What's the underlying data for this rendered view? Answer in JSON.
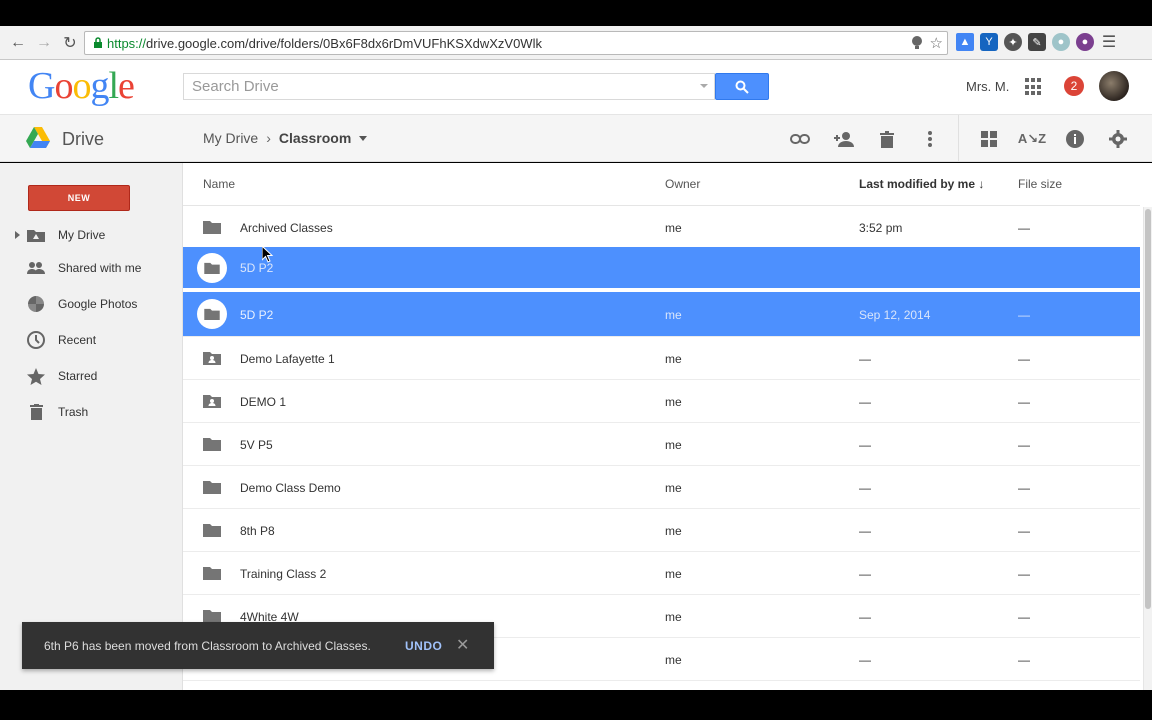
{
  "browser": {
    "url_scheme": "https://",
    "url_rest": "drive.google.com/drive/folders/0Bx6F8dx6rDmVUFhKSXdwXzV0Wlk"
  },
  "header": {
    "logo": [
      "G",
      "o",
      "o",
      "g",
      "l",
      "e"
    ],
    "logo_colors": [
      "#4285f4",
      "#ea4335",
      "#fbbc05",
      "#4285f4",
      "#34a853",
      "#ea4335"
    ],
    "search_placeholder": "Search Drive",
    "user_name": "Mrs. M.",
    "notification_count": "2"
  },
  "drive_bar": {
    "title": "Drive",
    "breadcrumb_root": "My Drive",
    "breadcrumb_current": "Classroom"
  },
  "sidebar": {
    "new_label": "NEW",
    "items": [
      {
        "label": "My Drive",
        "icon": "my-drive-icon"
      },
      {
        "label": "Shared with me",
        "icon": "people-icon"
      },
      {
        "label": "Google Photos",
        "icon": "photos-icon"
      },
      {
        "label": "Recent",
        "icon": "clock-icon"
      },
      {
        "label": "Starred",
        "icon": "star-icon"
      },
      {
        "label": "Trash",
        "icon": "trash-icon"
      }
    ]
  },
  "list": {
    "columns": {
      "name": "Name",
      "owner": "Owner",
      "modified": "Last modified by me",
      "size": "File size"
    },
    "drag_label": "5D P2",
    "rows": [
      {
        "name": "Archived Classes",
        "owner": "me",
        "modified": "3:52 pm",
        "size": "—",
        "icon": "folder-icon"
      },
      {
        "name": "5D P2",
        "owner": "me",
        "modified": "Sep 12, 2014",
        "size": "—",
        "icon": "folder-icon",
        "selected": true
      },
      {
        "name": "Demo Lafayette 1",
        "owner": "me",
        "modified": "—",
        "size": "—",
        "icon": "shared-folder-icon"
      },
      {
        "name": "DEMO 1",
        "owner": "me",
        "modified": "—",
        "size": "—",
        "icon": "shared-folder-icon"
      },
      {
        "name": "5V P5",
        "owner": "me",
        "modified": "—",
        "size": "—",
        "icon": "folder-icon"
      },
      {
        "name": "Demo Class Demo",
        "owner": "me",
        "modified": "—",
        "size": "—",
        "icon": "folder-icon"
      },
      {
        "name": "8th P8",
        "owner": "me",
        "modified": "—",
        "size": "—",
        "icon": "folder-icon"
      },
      {
        "name": "Training Class 2",
        "owner": "me",
        "modified": "—",
        "size": "—",
        "icon": "folder-icon"
      },
      {
        "name": "4White 4W",
        "owner": "me",
        "modified": "—",
        "size": "—",
        "icon": "folder-icon"
      },
      {
        "name": "",
        "owner": "me",
        "modified": "—",
        "size": "—",
        "icon": "folder-icon"
      }
    ]
  },
  "toast": {
    "message": "6th P6 has been moved from Classroom to Archived Classes.",
    "undo_label": "UNDO"
  }
}
